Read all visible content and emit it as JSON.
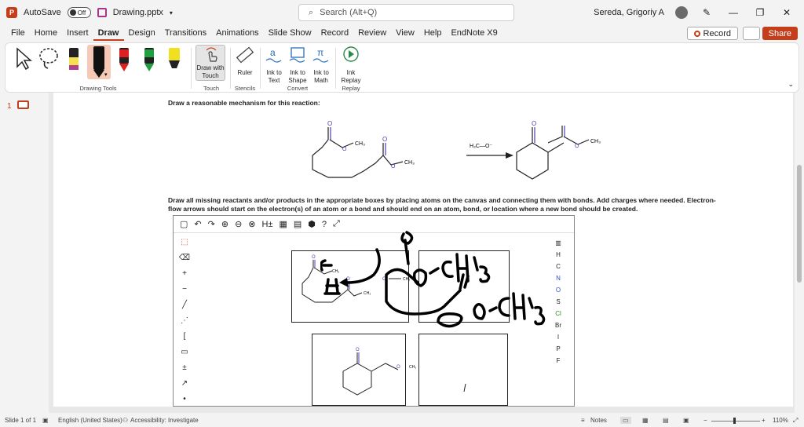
{
  "titlebar": {
    "autosave_label": "AutoSave",
    "autosave_state": "Off",
    "filename": "Drawing.pptx",
    "search_placeholder": "Search (Alt+Q)",
    "user_name": "Sereda, Grigoriy A"
  },
  "menu": {
    "items": [
      "File",
      "Home",
      "Insert",
      "Draw",
      "Design",
      "Transitions",
      "Animations",
      "Slide Show",
      "Record",
      "Review",
      "View",
      "Help",
      "EndNote X9"
    ],
    "active": "Draw",
    "record_label": "Record",
    "share_label": "Share"
  },
  "ribbon": {
    "drawing_tools_label": "Drawing Tools",
    "touch": {
      "button": "Draw with Touch",
      "group": "Touch"
    },
    "stencils": {
      "button": "Ruler",
      "group": "Stencils"
    },
    "convert": {
      "ink_to_text": "Ink to Text",
      "ink_to_shape": "Ink to Shape",
      "ink_to_math": "Ink to Math",
      "group": "Convert"
    },
    "replay": {
      "button": "Ink Replay",
      "group": "Replay"
    }
  },
  "slide_panel": {
    "slide_number": "1"
  },
  "slide": {
    "question1": "Draw a reasonable mechanism for this reaction:",
    "reagent_label": "H₃C—O⁻",
    "question2": "Draw all missing reactants and/or products in the appropriate boxes by placing atoms on the canvas and connecting them with bonds. Add charges where needed. Electron-flow arrows should start on the electron(s) of an atom or a bond and should end on an atom, bond, or location where a new bond should be created.",
    "elements": [
      "H",
      "C",
      "N",
      "O",
      "S",
      "Cl",
      "Br",
      "I",
      "P",
      "F"
    ]
  },
  "status": {
    "slide": "Slide 1 of 1",
    "language": "English (United States)",
    "accessibility": "Accessibility: Investigate",
    "notes": "Notes",
    "zoom": "110%"
  }
}
